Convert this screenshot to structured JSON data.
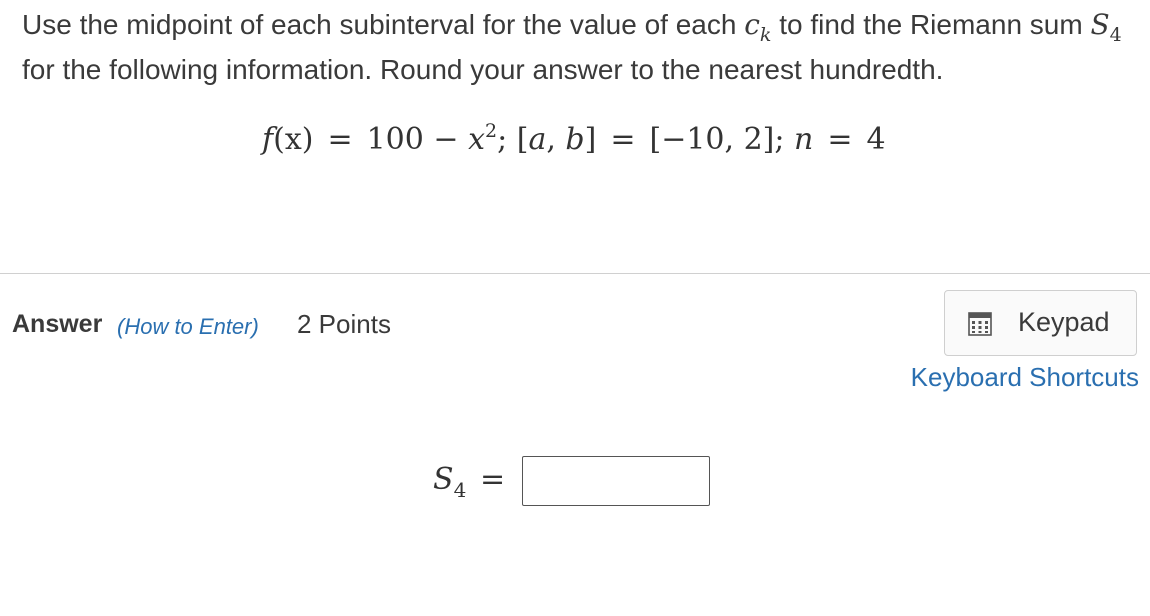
{
  "question": {
    "part1": "Use the midpoint of each subinterval for the value of each",
    "ck_var": "c",
    "ck_sub": "k",
    "part2": "to find the Riemann sum",
    "sum_var": "S",
    "sum_sub": "4",
    "part3": "for the following information. Round your answer to the nearest hundredth."
  },
  "formula": {
    "f_lhs": "f",
    "f_arg": "(x)",
    "eq1": "=",
    "expr_const": "100 − ",
    "expr_var": "x",
    "expr_exp": "2",
    "semi1": ";",
    "interval_lhs_open": "[",
    "interval_a": "a",
    "interval_comma": ", ",
    "interval_b": "b",
    "interval_lhs_close": "]",
    "eq2": "=",
    "interval_value": "[−10, 2];",
    "n_var": "n",
    "eq3": "=",
    "n_value": "4"
  },
  "answer": {
    "label": "Answer",
    "how_to": "(How to Enter)",
    "points": "2 Points",
    "keypad_label": "Keypad",
    "keyboard_shortcuts": "Keyboard Shortcuts",
    "input_var": "S",
    "input_sub": "4",
    "input_eq": "=",
    "input_value": ""
  },
  "colors": {
    "link": "#2a6fb0",
    "text": "#3a3a3a",
    "divider": "#d0d0d0"
  },
  "icons": {
    "keypad": "keypad-grid-icon"
  }
}
